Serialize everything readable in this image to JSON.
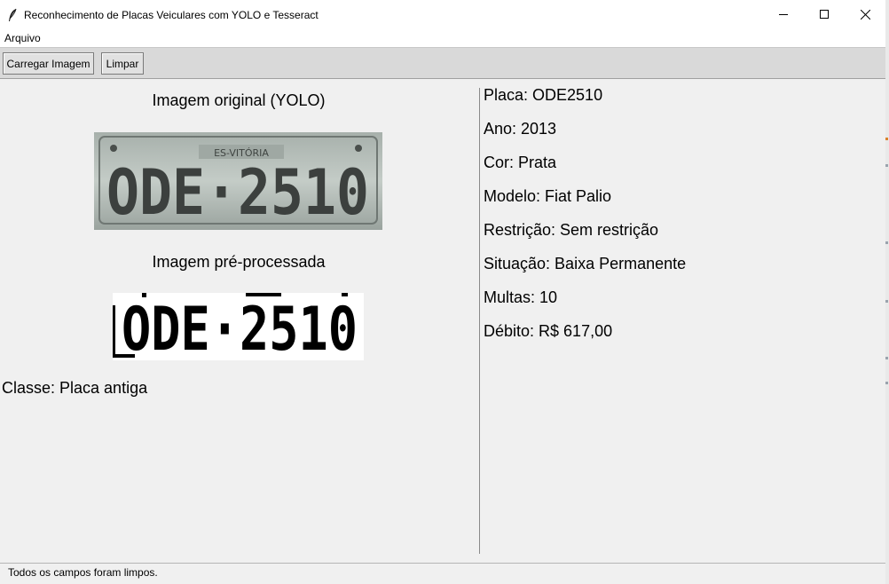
{
  "window": {
    "title": "Reconhecimento de Placas Veiculares com YOLO e Tesseract"
  },
  "menu": {
    "items": [
      "Arquivo"
    ]
  },
  "toolbar": {
    "load_label": "Carregar Imagem",
    "clear_label": "Limpar"
  },
  "left": {
    "original_title": "Imagem original (YOLO)",
    "processed_title": "Imagem pré-processada",
    "class_label": "Classe: Placa antiga",
    "plate_text": "ODE·2510",
    "plate_header": "ES-VITÓRIA"
  },
  "info": {
    "rows": [
      "Placa: ODE2510",
      "Ano: 2013",
      "Cor: Prata",
      "Modelo: Fiat Palio",
      "Restrição: Sem restrição",
      "Situação: Baixa Permanente",
      "Multas: 10",
      "Débito: R$ 617,00"
    ]
  },
  "status": {
    "text": "Todos os campos foram limpos."
  },
  "icons": {
    "app": "feather-icon",
    "minimize": "minimize-icon",
    "maximize": "maximize-icon",
    "close": "close-icon"
  },
  "colors": {
    "window_bg": "#f0f0f0",
    "toolbar_bg": "#d9d9d9",
    "plate_bg": "#b9c2bd",
    "plate_text": "#3c403e"
  }
}
